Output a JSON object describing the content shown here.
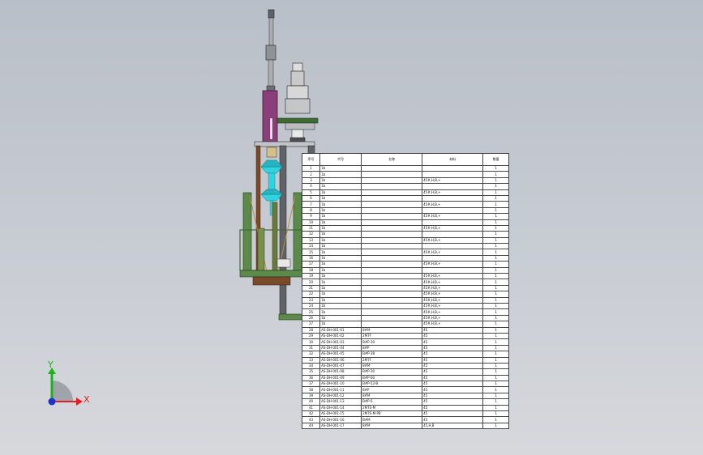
{
  "viewport": {
    "background_top": "#b9bfc8",
    "background_bottom": "#d6d8dc"
  },
  "model": {
    "colors": {
      "frame_green": "#5c8a4a",
      "dark_green": "#3e6b33",
      "purple_column": "#8a3f7a",
      "cyan_part": "#2fd4e0",
      "steel": "#a9adb2",
      "dark_steel": "#5f6368",
      "brown": "#7a4a2a"
    }
  },
  "triad": {
    "x_label": "X",
    "y_label": "Y",
    "x_color": "#e02020",
    "y_color": "#1fb21f",
    "z_color": "#2030d0"
  },
  "bom": {
    "headers": [
      "序号",
      "代号",
      "名称",
      "材料",
      "数量"
    ],
    "rows": [
      [
        "1",
        "1b",
        "",
        "",
        "1"
      ],
      [
        "2",
        "1b",
        "",
        "",
        "1"
      ],
      [
        "3",
        "1b",
        "",
        "45#,H,B,+",
        "1"
      ],
      [
        "4",
        "1b",
        "",
        "",
        "1"
      ],
      [
        "5",
        "1b",
        "",
        "45#,H,B,+",
        "1"
      ],
      [
        "6",
        "1b",
        "",
        "",
        "1"
      ],
      [
        "7",
        "1b",
        "",
        "45#,H,B,+",
        "1"
      ],
      [
        "8",
        "1b",
        "",
        "",
        "1"
      ],
      [
        "9",
        "1b",
        "",
        "45#,H,B,+",
        "1"
      ],
      [
        "10",
        "1b",
        "",
        "",
        "1"
      ],
      [
        "11",
        "1b",
        "",
        "45#,H,B,+",
        "1"
      ],
      [
        "12",
        "1b",
        "",
        "",
        "1"
      ],
      [
        "13",
        "1b",
        "",
        "45#,H,B,+",
        "1"
      ],
      [
        "14",
        "1b",
        "",
        "",
        "1"
      ],
      [
        "15",
        "1b",
        "",
        "45#,H,B,+",
        "1"
      ],
      [
        "16",
        "1b",
        "",
        "",
        "1"
      ],
      [
        "17",
        "1b",
        "",
        "45#,H,B,+",
        "1"
      ],
      [
        "18",
        "1b",
        "",
        "",
        "1"
      ],
      [
        "19",
        "1b",
        "",
        "45#,H,B,+",
        "1"
      ],
      [
        "20",
        "1b",
        "",
        "45#,H,B,+",
        "1"
      ],
      [
        "21",
        "1b",
        "",
        "45#,H,B,+",
        "1"
      ],
      [
        "22",
        "1b",
        "",
        "45#,H,B,+",
        "1"
      ],
      [
        "23",
        "1b",
        "",
        "45#,H,B,+",
        "1"
      ],
      [
        "24",
        "1b",
        "",
        "45#,H,B,+",
        "1"
      ],
      [
        "25",
        "1b",
        "",
        "45#,H,B,+",
        "1"
      ],
      [
        "26",
        "1b",
        "",
        "45#,H,B,+",
        "1"
      ],
      [
        "27",
        "1b",
        "",
        "45#,H,B,+",
        "1"
      ],
      [
        "28",
        "AS-DH-001-01",
        "8#M",
        "45",
        "1"
      ],
      [
        "29",
        "AS-DH-001-02",
        "2M7F",
        "45",
        "1"
      ],
      [
        "30",
        "AS-DH-001-03",
        "B#P-30",
        "45",
        "1"
      ],
      [
        "31",
        "AS-DH-001-04",
        "8#P",
        "45",
        "1"
      ],
      [
        "32",
        "AS-DH-001-05",
        "B#P-38",
        "45",
        "1"
      ],
      [
        "33",
        "AS-DH-001-06",
        "2M7F",
        "45",
        "1"
      ],
      [
        "34",
        "AS-DH-001-07",
        "8#M",
        "45",
        "1"
      ],
      [
        "35",
        "AS-DH-001-08",
        "B#P-30",
        "45",
        "1"
      ],
      [
        "36",
        "AS-DH-001-09",
        "B#P-60",
        "45",
        "1"
      ],
      [
        "37",
        "AS-DH-001-10",
        "B#P-52-B",
        "45",
        "1"
      ],
      [
        "38",
        "AS-DH-001-11",
        "8#P",
        "45",
        "1"
      ],
      [
        "39",
        "AS-DH-001-12",
        "8#M",
        "45",
        "1"
      ],
      [
        "40",
        "AS-DH-001-13",
        "B#P-S",
        "45",
        "1"
      ],
      [
        "41",
        "AS-DH-001-14",
        "2M7S-M",
        "45",
        "1"
      ],
      [
        "42",
        "AS-DH-001-15",
        "2M7S-M-PB",
        "45",
        "1"
      ],
      [
        "43",
        "AS-DH-001-16",
        "B#M",
        "45",
        "1"
      ],
      [
        "44",
        "AS-DH-001-17",
        "8#M",
        "45,H,B",
        "1"
      ]
    ]
  }
}
